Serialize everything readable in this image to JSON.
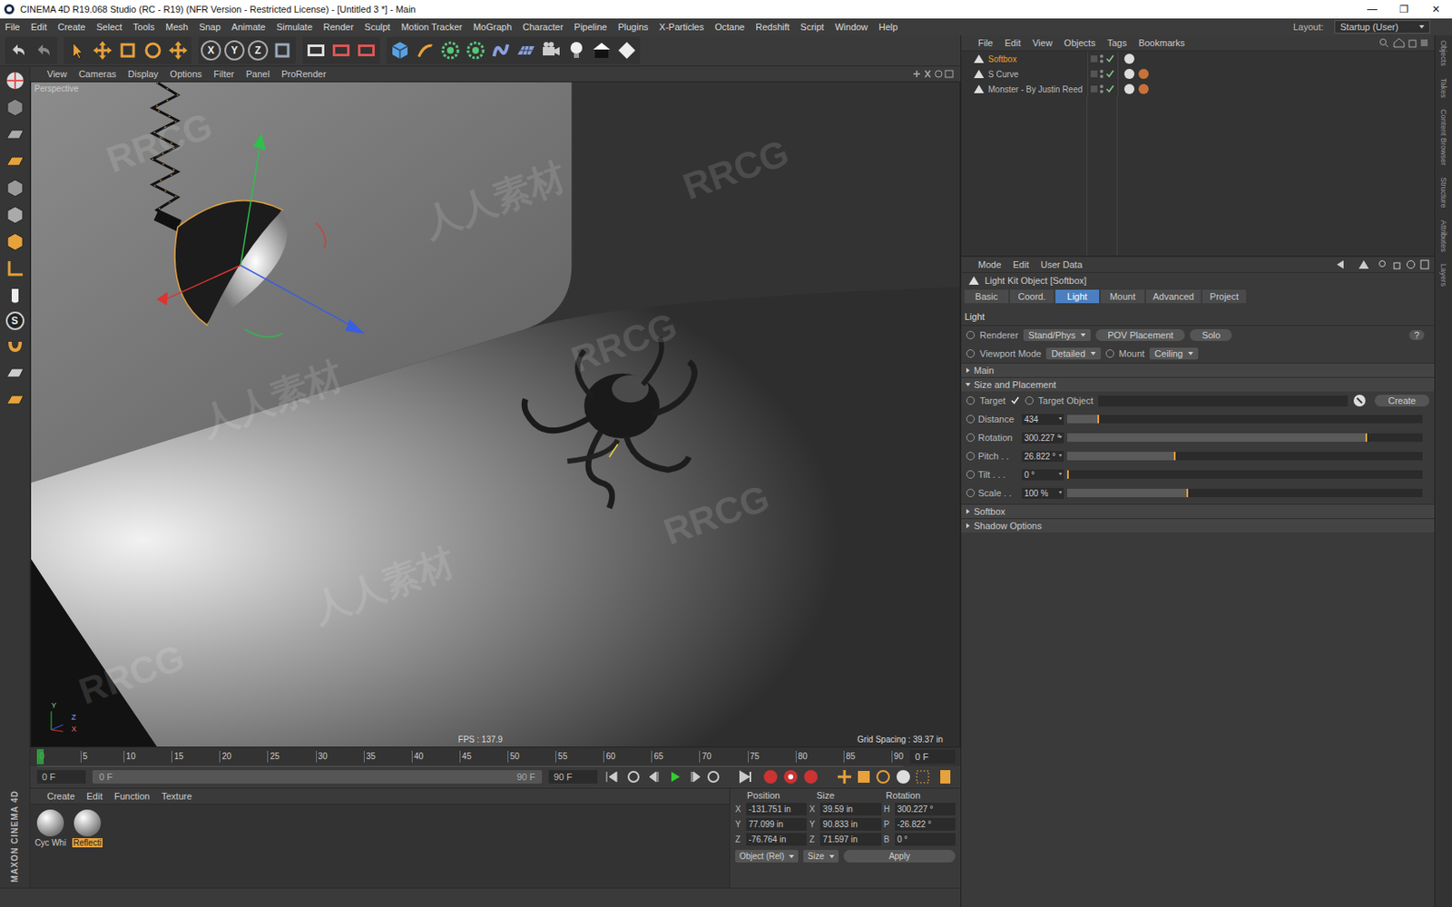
{
  "window": {
    "title": "CINEMA 4D R19.068 Studio (RC - R19) (NFR Version - Restricted License) - [Untitled 3 *] - Main",
    "controls": [
      "—",
      "❐",
      "✕"
    ]
  },
  "menu": [
    "File",
    "Edit",
    "Create",
    "Select",
    "Tools",
    "Mesh",
    "Snap",
    "Animate",
    "Simulate",
    "Render",
    "Sculpt",
    "Motion Tracker",
    "MoGraph",
    "Character",
    "Pipeline",
    "Plugins",
    "X-Particles",
    "Octane",
    "Redshift",
    "Script",
    "Window",
    "Help"
  ],
  "layout": {
    "label": "Layout:",
    "value": "Startup (User)"
  },
  "toolbar_axes": [
    "X",
    "Y",
    "Z"
  ],
  "palette": {
    "snap": "S"
  },
  "brand": "MAXON CINEMA 4D",
  "viewport": {
    "menu": [
      "View",
      "Cameras",
      "Display",
      "Options",
      "Filter",
      "Panel",
      "ProRender"
    ],
    "camera": "Perspective",
    "fps": "FPS : 137.9",
    "grid": "Grid Spacing : 39.37 in",
    "axes": [
      "Y",
      "Z",
      "X"
    ]
  },
  "watermarks": [
    "RRCG",
    "人人素材"
  ],
  "object_manager": {
    "menu": [
      "File",
      "Edit",
      "View",
      "Objects",
      "Tags",
      "Bookmarks"
    ],
    "objects": [
      {
        "name": "Softbox",
        "selected": true,
        "tags": 1
      },
      {
        "name": "S Curve",
        "selected": false,
        "tags": 2
      },
      {
        "name": "Monster - By Justin Reed",
        "selected": false,
        "tags": 2
      }
    ]
  },
  "attributes": {
    "menu": [
      "Mode",
      "Edit",
      "User Data"
    ],
    "title": "Light Kit Object [Softbox]",
    "tabs": [
      {
        "label": "Basic",
        "selected": false
      },
      {
        "label": "Coord.",
        "selected": false
      },
      {
        "label": "Light",
        "selected": true
      },
      {
        "label": "Mount",
        "selected": false
      },
      {
        "label": "Advanced",
        "selected": false
      },
      {
        "label": "Project",
        "selected": false
      }
    ],
    "section": "Light",
    "renderer": {
      "label": "Renderer",
      "value": "Stand/Phys"
    },
    "buttons": [
      "POV Placement",
      "Solo"
    ],
    "help": "?",
    "viewport_mode": {
      "label": "Viewport Mode",
      "value": "Detailed"
    },
    "mount": {
      "label": "Mount",
      "value": "Ceiling"
    },
    "groups": [
      {
        "label": "Main",
        "expanded": false
      },
      {
        "label": "Size and Placement",
        "expanded": true
      },
      {
        "label": "Softbox",
        "expanded": false
      },
      {
        "label": "Shadow Options",
        "expanded": false
      }
    ],
    "target": {
      "label": "Target",
      "checked": true
    },
    "target_object": {
      "label": "Target Object",
      "value": ""
    },
    "create": "Create",
    "params": [
      {
        "label": "Distance",
        "value": "434",
        "level": 0.084
      },
      {
        "label": "Rotation",
        "value": "300.227 °",
        "level": 0.84
      },
      {
        "label": "Pitch . .",
        "value": "26.822 °",
        "level": 0.3
      },
      {
        "label": "Tilt . . .",
        "value": "0 °",
        "level": 0
      },
      {
        "label": "Scale . .",
        "value": "100 %",
        "level": 0.335
      }
    ]
  },
  "timeline": {
    "ticks": [
      "0",
      "5",
      "10",
      "15",
      "20",
      "25",
      "30",
      "35",
      "40",
      "45",
      "50",
      "55",
      "60",
      "65",
      "70",
      "75",
      "80",
      "85",
      "90"
    ],
    "frame": "0 F",
    "playhead": 0,
    "start": "0 F",
    "scrub_start": "0 F",
    "scrub_end": "90 F",
    "end": "90 F"
  },
  "materials": {
    "menu": [
      "Create",
      "Edit",
      "Function",
      "Texture"
    ],
    "items": [
      {
        "name": "Cyc Whi",
        "selected": false
      },
      {
        "name": "Reflecti",
        "selected": true
      }
    ]
  },
  "coordinates": {
    "headers": [
      "Position",
      "Size",
      "Rotation"
    ],
    "rows": [
      {
        "axis": "X",
        "position": "-131.751 in",
        "size_axis": "X",
        "size": "39.59 in",
        "rot_axis": "H",
        "rotation": "300.227 °"
      },
      {
        "axis": "Y",
        "position": "77.099 in",
        "size_axis": "Y",
        "size": "90.833 in",
        "rot_axis": "P",
        "rotation": "-26.822 °"
      },
      {
        "axis": "Z",
        "position": "-76.764 in",
        "size_axis": "Z",
        "size": "71.597 in",
        "rot_axis": "B",
        "rotation": "0 °"
      }
    ],
    "mode": "Object (Rel)",
    "size_mode": "Size",
    "apply": "Apply"
  },
  "side_tabs": [
    "Objects",
    "Takes",
    "Content Browser",
    "Structure",
    "Attributes",
    "Layers"
  ]
}
